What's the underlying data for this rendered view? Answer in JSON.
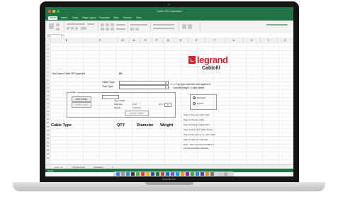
{
  "device": {
    "chin_label": "MacBook"
  },
  "app": {
    "title": "Cable Fill Calculator",
    "accent": "#217346"
  },
  "ribbon_tabs": [
    "Home",
    "Insert",
    "Draw",
    "Page Layout",
    "Formulas",
    "Data",
    "Review",
    "View"
  ],
  "formula_bar": {
    "name_box": "A1",
    "fx": "fx"
  },
  "columns": [
    "B",
    "F",
    "M",
    "N",
    "O",
    "P",
    "Q",
    "R",
    "S",
    "T",
    "U",
    "X",
    "Y",
    "Z"
  ],
  "rows": [
    "1",
    "2",
    "3",
    "4",
    "5",
    "6",
    "7",
    "8",
    "9",
    "10",
    "11",
    "12",
    "13",
    "14",
    "15",
    "16",
    "17",
    "18",
    "19",
    "20",
    "21",
    "22",
    "23",
    "24",
    "25",
    "26",
    "27",
    "28",
    "29",
    "30"
  ],
  "brand": {
    "logo": "legrand",
    "product": "Cablofil",
    "color": "#d2232a"
  },
  "sheet": {
    "fill_label": "Total Speed Cable Fill Capacity%",
    "fill_value": "8%",
    "cable_type_label": "Cable Type",
    "tray_type_label": "Tray Type",
    "tray_note_line1": "<<<<Tray type selection only applies to",
    "tray_note_line2": "Cablofil straight, & data cables",
    "group_title": "Cable:",
    "add_cable_btn": "Add Cable",
    "delete_cable_btn": "Delete cable",
    "type_cable_label": "Type Cable",
    "diameter_label": "Diameter",
    "diameter_value": "0.43\"",
    "weight_label": "Weight",
    "weight_value": "0.10 lb/ft",
    "qty_label": "QTY",
    "qty_value": "1",
    "insert_btn": "Insert Cable",
    "radio_standard": "Standard",
    "radio_hybrid": "Hybrid",
    "table_headers": [
      "Cable Type",
      "QTY",
      "Diameter",
      "Weight"
    ],
    "steps": [
      "Step 1) Choose Cable Type",
      "Step 2) Choose Cable",
      "Step 3) Change Cable QTY",
      "Step 4) Click Add Cable Button",
      "Step 5) Repeat 1-4 for each cable",
      "Step 6) Click on Calculate",
      "Note - After removing 2 cables it",
      "will automatically calculate"
    ]
  },
  "sheet_tabs": [
    "Cable Fill",
    "Product Data",
    "Selections"
  ],
  "status": {
    "text": "Ready"
  }
}
